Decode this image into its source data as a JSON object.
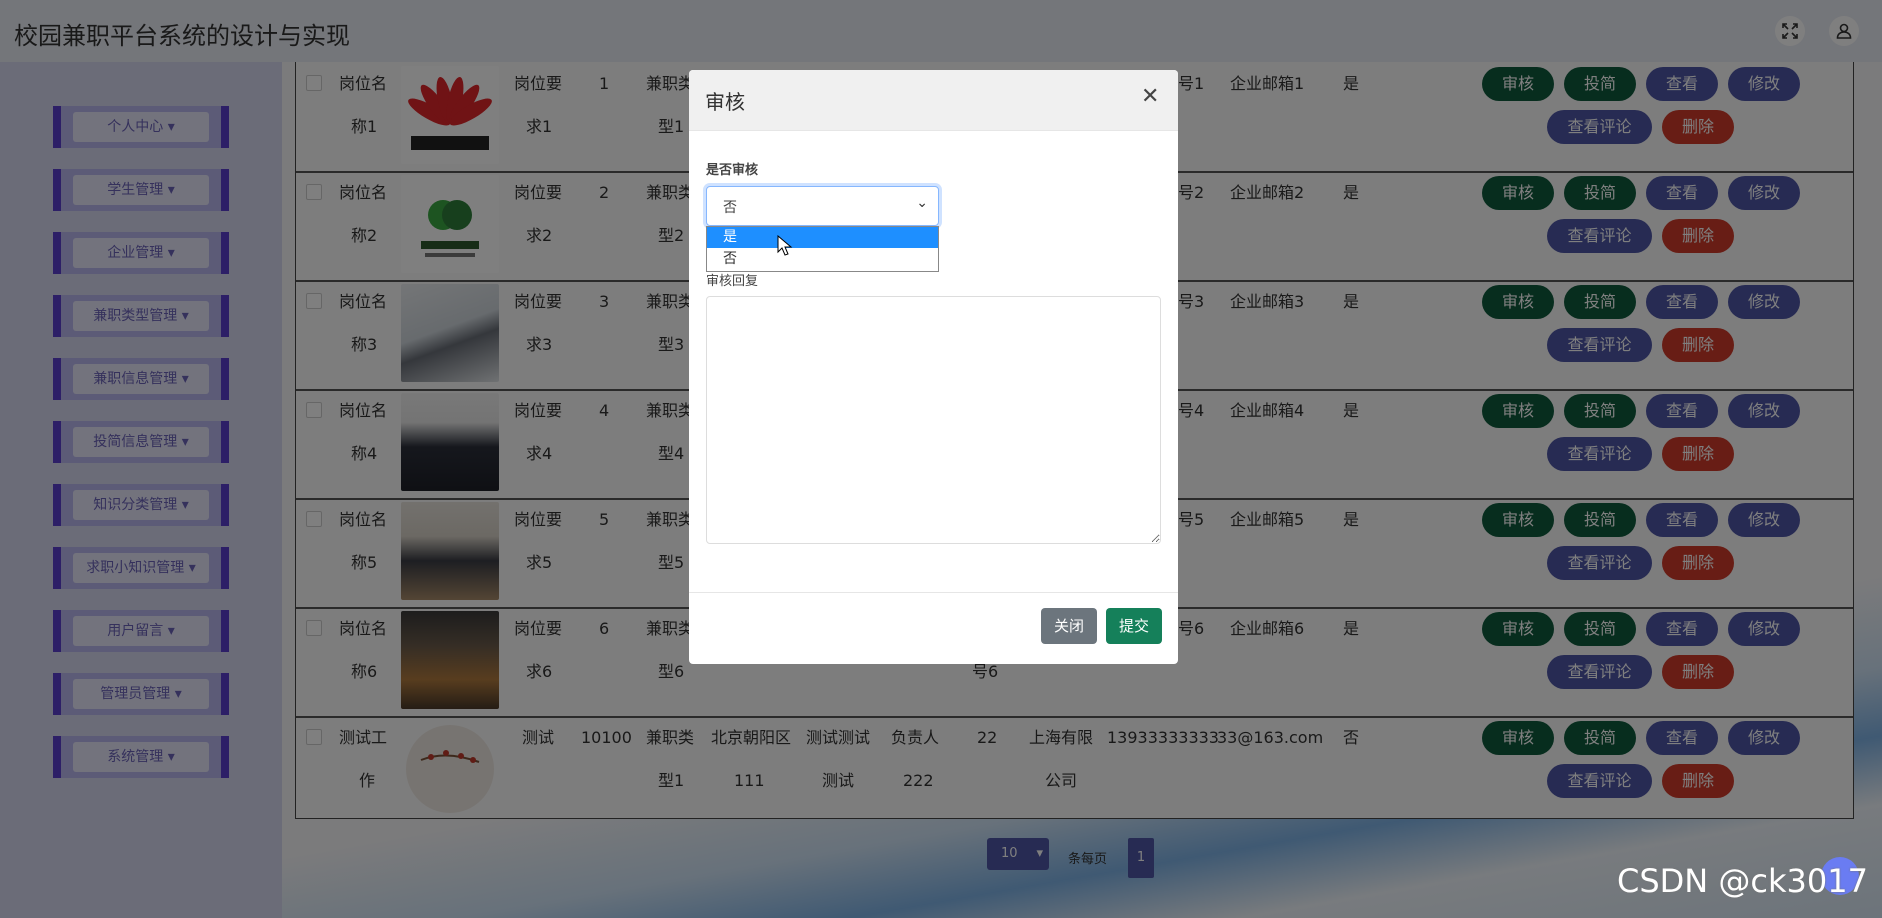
{
  "app": {
    "title": "校园兼职平台系统的设计与实现"
  },
  "sidebar": {
    "items": [
      "个人中心",
      "学生管理",
      "企业管理",
      "兼职类型管理",
      "兼职信息管理",
      "投简信息管理",
      "知识分类管理",
      "求职小知识管理",
      "用户留言",
      "管理员管理",
      "系统管理"
    ]
  },
  "actions": {
    "audit": "审核",
    "apply": "投简",
    "view": "查看",
    "edit": "修改",
    "comments": "查看评论",
    "delete": "删除"
  },
  "rows": [
    {
      "name1": "岗位名",
      "name2": "称1",
      "req1": "岗位要",
      "req2": "求1",
      "num": "1",
      "type1": "兼职类",
      "type2": "型1",
      "mid1": "",
      "mid2": "",
      "mid3": "",
      "mid4": "",
      "phone": "号1",
      "email": "企业邮箱1",
      "flag": "是",
      "image": "huawei-logo"
    },
    {
      "name1": "岗位名",
      "name2": "称2",
      "req1": "岗位要",
      "req2": "求2",
      "num": "2",
      "type1": "兼职类",
      "type2": "型2",
      "mid1": "",
      "mid2": "",
      "mid3": "",
      "mid4": "",
      "phone": "号2",
      "email": "企业邮箱2",
      "flag": "是",
      "image": "medical-logo"
    },
    {
      "name1": "岗位名",
      "name2": "称3",
      "req1": "岗位要",
      "req2": "求3",
      "num": "3",
      "type1": "兼职类",
      "type2": "型3",
      "mid1": "",
      "mid2": "",
      "mid3": "",
      "mid4": "",
      "phone": "号3",
      "email": "企业邮箱3",
      "flag": "是",
      "image": "office-photo"
    },
    {
      "name1": "岗位名",
      "name2": "称4",
      "req1": "岗位要",
      "req2": "求4",
      "num": "4",
      "type1": "兼职类",
      "type2": "型4",
      "mid1": "",
      "mid2": "",
      "mid3": "",
      "mid4": "",
      "phone": "号4",
      "email": "企业邮箱4",
      "flag": "是",
      "image": "interview-photo"
    },
    {
      "name1": "岗位名",
      "name2": "称5",
      "req1": "岗位要",
      "req2": "求5",
      "num": "5",
      "type1": "兼职类",
      "type2": "型5",
      "mid1": "",
      "mid2": "",
      "mid3": "",
      "mid4": "",
      "phone": "号5",
      "email": "企业邮箱5",
      "flag": "是",
      "image": "meeting-photo"
    },
    {
      "name1": "岗位名",
      "name2": "称6",
      "req1": "岗位要",
      "req2": "求6",
      "num": "6",
      "type1": "兼职类",
      "type2": "型6",
      "mid1": "",
      "mid2": "",
      "mid3": "",
      "mid4": "号6",
      "phone": "号6",
      "email": "企业邮箱6",
      "flag": "是",
      "image": "restaurant-photo"
    },
    {
      "name1": "测试工",
      "name2": "作",
      "req1": "测试",
      "req2": "",
      "num": "10100",
      "type1": "兼职类",
      "type2": "型1",
      "mid1": "北京朝阳区",
      "mid1b": "111",
      "mid2": "测试测试",
      "mid2b": "测试",
      "mid3": "负责人",
      "mid3b": "222",
      "mid4": "22",
      "company1": "上海有限",
      "company2": "公司",
      "phone": "13933333333",
      "email": "33@163.com",
      "flag": "否",
      "image": "blossom-plate"
    }
  ],
  "pagination": {
    "per_page_value": "10",
    "per_page_label": "条每页",
    "current_page": "1"
  },
  "modal": {
    "title": "审核",
    "field_label": "是否审核",
    "select_value": "否",
    "options": [
      "是",
      "否"
    ],
    "highlighted_option": "是",
    "reply_label": "审核回复",
    "reply_value": "",
    "close_label": "关闭",
    "submit_label": "提交"
  },
  "watermark": "CSDN @ck3017",
  "colors": {
    "audit": "#0f5a3c",
    "apply": "#0f5a3c",
    "view": "#4e56a6",
    "edit": "#4e56a6",
    "comments": "#4e56a6",
    "delete": "#d03b2a",
    "submit": "#15805a",
    "close": "#6c757d",
    "highlight": "#1e8fff"
  },
  "icons": [
    "fullscreen-icon",
    "user-icon",
    "chevron-down-icon",
    "close-icon",
    "pointer-cursor-icon"
  ]
}
